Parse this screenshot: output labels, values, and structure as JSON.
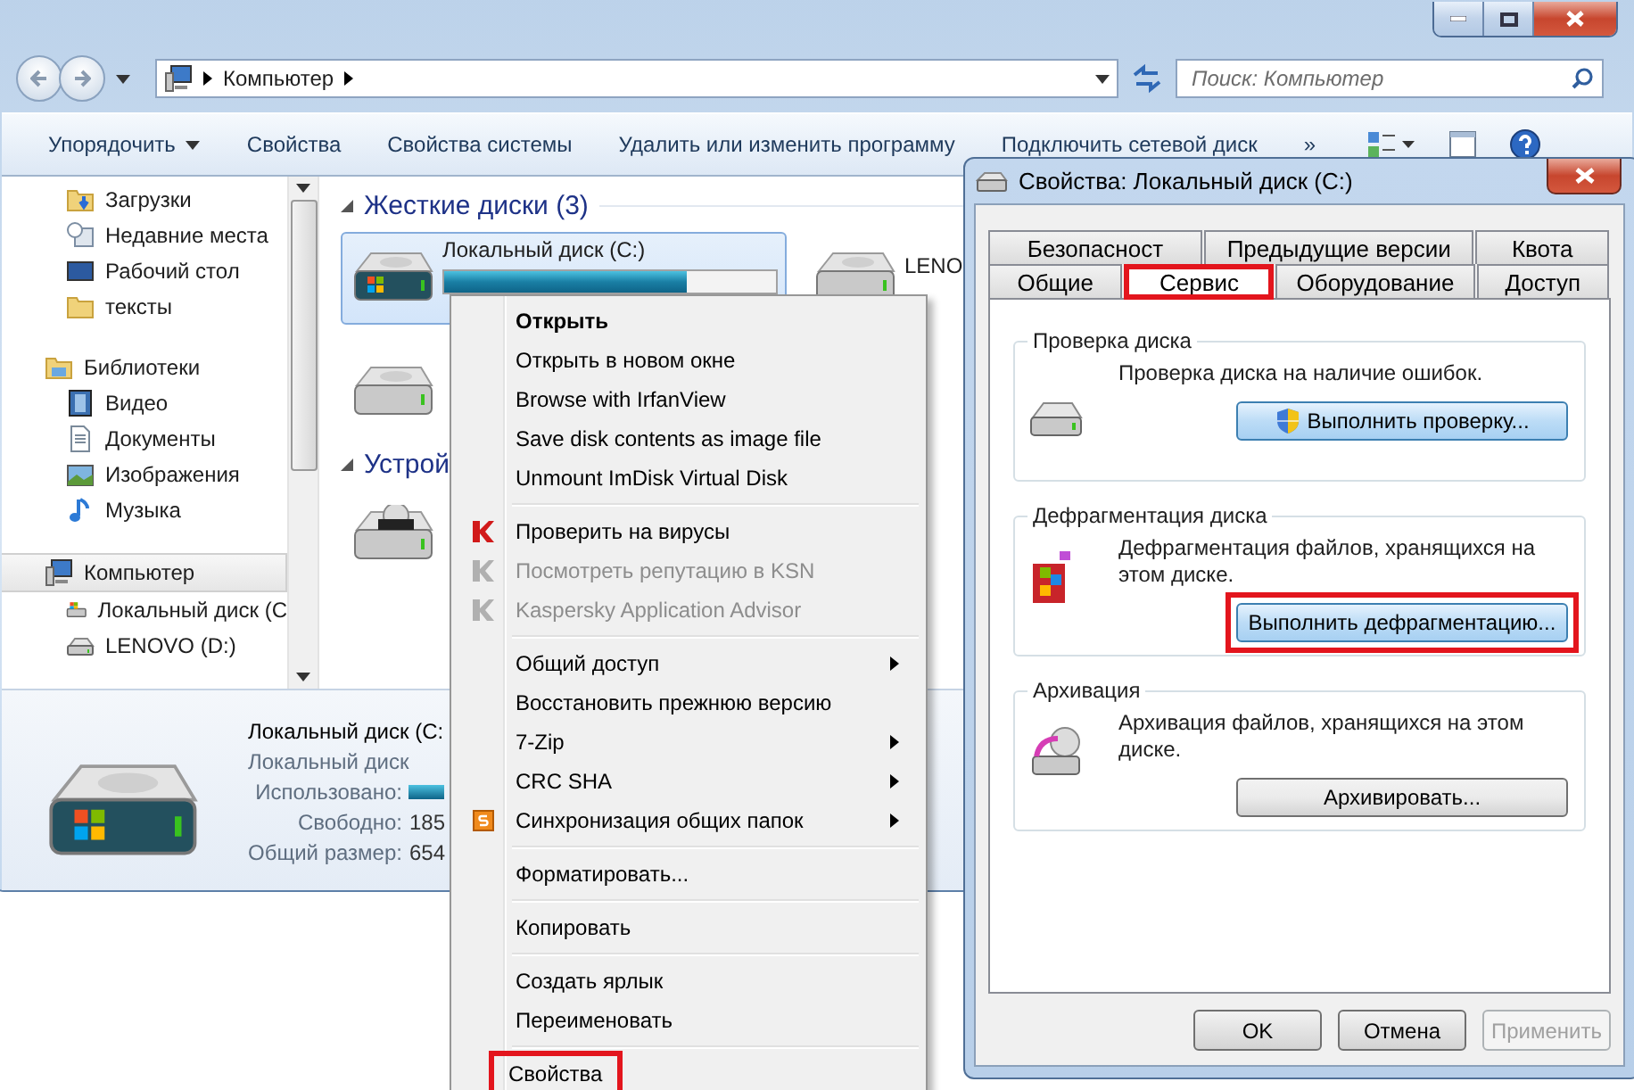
{
  "explorer": {
    "address": {
      "crumbs": [
        "Компьютер"
      ]
    },
    "search": {
      "placeholder": "Поиск: Компьютер"
    },
    "toolbar": [
      {
        "label": "Упорядочить",
        "dropdown": true
      },
      {
        "label": "Свойства",
        "dropdown": false
      },
      {
        "label": "Свойства системы",
        "dropdown": false
      },
      {
        "label": "Удалить или изменить программу",
        "dropdown": false
      },
      {
        "label": "Подключить сетевой диск",
        "dropdown": false
      },
      {
        "label": "»",
        "dropdown": false
      }
    ],
    "nav": [
      {
        "children": [
          {
            "label": "Загрузки",
            "selected": false
          },
          {
            "label": "Недавние места",
            "selected": false
          },
          {
            "label": "Рабочий стол",
            "selected": false
          },
          {
            "label": "тексты",
            "selected": false
          }
        ]
      },
      {
        "label": "Библиотеки",
        "selected": false,
        "children": [
          {
            "label": "Видео",
            "selected": false
          },
          {
            "label": "Документы",
            "selected": false
          },
          {
            "label": "Изображения",
            "selected": false
          },
          {
            "label": "Музыка",
            "selected": false
          }
        ]
      },
      {
        "label": "Компьютер",
        "selected": true,
        "children": [
          {
            "label": "Локальный диск (C",
            "selected": false
          },
          {
            "label": "LENOVO (D:)",
            "selected": false
          }
        ]
      }
    ],
    "groups": [
      {
        "title": "Жесткие диски (3)",
        "items": [
          {
            "name": "Локальный диск (C:)",
            "selected": true,
            "level": 0.73
          },
          {
            "name": "LENO",
            "selected": false
          },
          {
            "selected": false
          }
        ]
      },
      {
        "title": "Устрой",
        "items": [
          {
            "selected": false
          }
        ]
      }
    ],
    "details": {
      "name": "Локальный диск (C:",
      "type": "Локальный диск",
      "fields": [
        {
          "label": "Использовано:",
          "kind": "bar"
        },
        {
          "label": "Свободно:",
          "kind": "text",
          "value": "185"
        },
        {
          "label": "Общий размер:",
          "kind": "text",
          "value": "654"
        }
      ]
    }
  },
  "context_menu": {
    "items": [
      {
        "kind": "item",
        "label": "Открыть",
        "bold": true,
        "disabled": false,
        "submenu": false,
        "annotated": false
      },
      {
        "kind": "item",
        "label": "Открыть в новом окне",
        "bold": false,
        "disabled": false,
        "submenu": false,
        "annotated": false
      },
      {
        "kind": "item",
        "label": "Browse with IrfanView",
        "bold": false,
        "disabled": false,
        "submenu": false,
        "annotated": false
      },
      {
        "kind": "item",
        "label": "Save disk contents as image file",
        "bold": false,
        "disabled": false,
        "submenu": false,
        "annotated": false
      },
      {
        "kind": "item",
        "label": "Unmount ImDisk Virtual Disk",
        "bold": false,
        "disabled": false,
        "submenu": false,
        "annotated": false
      },
      {
        "kind": "separator"
      },
      {
        "kind": "item",
        "label": "Проверить на вирусы",
        "bold": false,
        "disabled": false,
        "submenu": false,
        "annotated": false
      },
      {
        "kind": "item",
        "label": "Посмотреть репутацию в KSN",
        "bold": false,
        "disabled": true,
        "submenu": false,
        "annotated": false
      },
      {
        "kind": "item",
        "label": "Kaspersky Application Advisor",
        "bold": false,
        "disabled": true,
        "submenu": false,
        "annotated": false
      },
      {
        "kind": "separator"
      },
      {
        "kind": "item",
        "label": "Общий доступ",
        "bold": false,
        "disabled": false,
        "submenu": true,
        "annotated": false
      },
      {
        "kind": "item",
        "label": "Восстановить прежнюю версию",
        "bold": false,
        "disabled": false,
        "submenu": false,
        "annotated": false
      },
      {
        "kind": "item",
        "label": "7-Zip",
        "bold": false,
        "disabled": false,
        "submenu": true,
        "annotated": false
      },
      {
        "kind": "item",
        "label": "CRC SHA",
        "bold": false,
        "disabled": false,
        "submenu": true,
        "annotated": false
      },
      {
        "kind": "item",
        "label": "Синхронизация общих папок",
        "bold": false,
        "disabled": false,
        "submenu": true,
        "annotated": false
      },
      {
        "kind": "separator"
      },
      {
        "kind": "item",
        "label": "Форматировать...",
        "bold": false,
        "disabled": false,
        "submenu": false,
        "annotated": false
      },
      {
        "kind": "separator"
      },
      {
        "kind": "item",
        "label": "Копировать",
        "bold": false,
        "disabled": false,
        "submenu": false,
        "annotated": false
      },
      {
        "kind": "separator"
      },
      {
        "kind": "item",
        "label": "Создать ярлык",
        "bold": false,
        "disabled": false,
        "submenu": false,
        "annotated": false
      },
      {
        "kind": "item",
        "label": "Переименовать",
        "bold": false,
        "disabled": false,
        "submenu": false,
        "annotated": false
      },
      {
        "kind": "separator"
      },
      {
        "kind": "item",
        "label": "Свойства",
        "bold": false,
        "disabled": false,
        "submenu": false,
        "annotated": true
      }
    ]
  },
  "dialog": {
    "title": "Свойства: Локальный диск (C:)",
    "tab_rows": [
      [
        {
          "label": "Безопасност",
          "selected": false,
          "annotated": false
        },
        {
          "label": "Предыдущие версии",
          "selected": false,
          "annotated": false
        },
        {
          "label": "Квота",
          "selected": false,
          "annotated": false
        }
      ],
      [
        {
          "label": "Общие",
          "selected": false,
          "annotated": false
        },
        {
          "label": "Сервис",
          "selected": true,
          "annotated": true
        },
        {
          "label": "Оборудование",
          "selected": false,
          "annotated": false
        },
        {
          "label": "Доступ",
          "selected": false,
          "annotated": false
        }
      ]
    ],
    "groups": [
      {
        "title": "Проверка диска",
        "text": "Проверка диска на наличие ошибок.",
        "button": {
          "label": "Выполнить проверку...",
          "shield": true,
          "annotated": false
        }
      },
      {
        "title": "Дефрагментация диска",
        "text": "Дефрагментация файлов, хранящихся на этом диске.",
        "button": {
          "label": "Выполнить дефрагментацию...",
          "shield": false,
          "annotated": true
        }
      },
      {
        "title": "Архивация",
        "text": "Архивация файлов, хранящихся на этом диске.",
        "button": {
          "label": "Архивировать...",
          "shield": false,
          "annotated": false
        }
      }
    ],
    "buttons": [
      {
        "label": "OK",
        "disabled": false
      },
      {
        "label": "Отмена",
        "disabled": false
      },
      {
        "label": "Применить",
        "disabled": true
      }
    ]
  }
}
